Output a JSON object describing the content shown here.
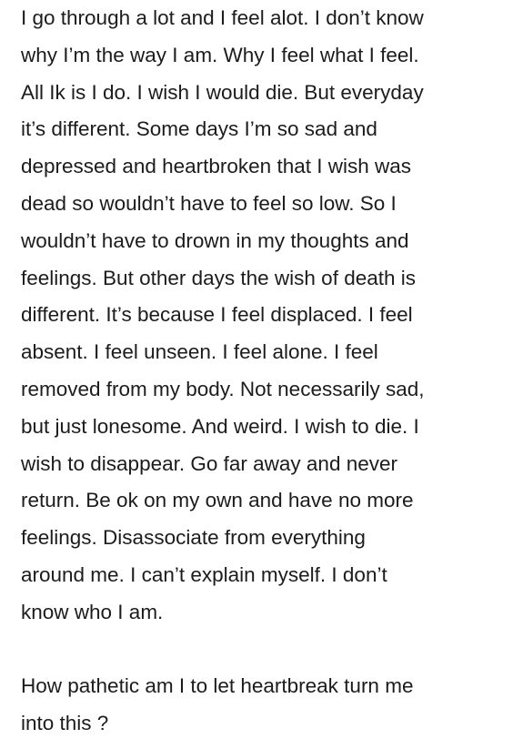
{
  "note": {
    "paragraphs": [
      {
        "lines": [
          "I go through a lot and I feel alot. I don’t know",
          "why I’m the way I am. Why I feel what I feel.",
          "All Ik is I do. I wish I would die. But everyday",
          "it’s different. Some days I’m so sad and",
          "depressed and heartbroken that I wish was",
          "dead so wouldn’t have to feel so low. So I",
          "wouldn’t have to drown in my thoughts and",
          "feelings. But other days the wish of death is",
          "different. It’s because I feel displaced. I feel",
          "absent. I feel unseen. I feel alone. I feel",
          "removed from my body. Not necessarily sad,",
          "but just lonesome. And weird. I wish to die. I",
          "wish to disappear. Go far away and never",
          "return. Be ok on my own and have no more",
          "feelings. Disassociate from everything",
          "around me. I can’t explain myself. I don’t",
          "know who I am."
        ]
      },
      {
        "lines": [
          "How pathetic am I to let heartbreak turn me",
          "into this ?"
        ]
      }
    ]
  }
}
